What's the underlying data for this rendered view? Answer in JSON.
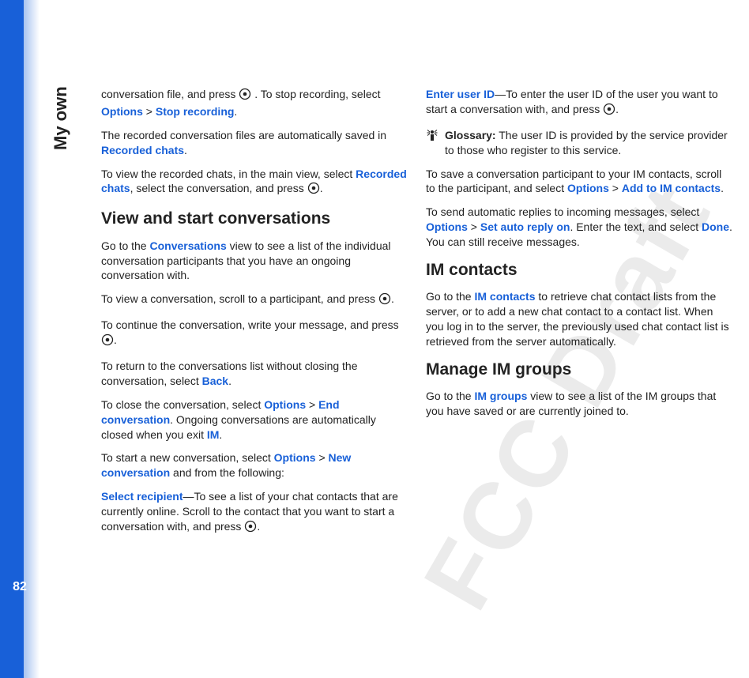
{
  "meta": {
    "side_title": "My own",
    "page_number": "82",
    "watermark": "FCC Draft"
  },
  "left": {
    "p1_a": "conversation file, and press ",
    "p1_b": ". To stop recording, select ",
    "p1_opt": "Options",
    "p1_gt": " > ",
    "p1_stop": "Stop recording",
    "p1_end": ".",
    "p2_a": "The recorded conversation files are automatically saved in ",
    "p2_rec": "Recorded chats",
    "p2_end": ".",
    "p3_a": "To view the recorded chats, in the main view, select ",
    "p3_rec": "Recorded chats",
    "p3_b": ", select the conversation, and press ",
    "p3_end": ".",
    "h_view": "View and start conversations",
    "p4_a": "Go to the ",
    "p4_conv": "Conversations",
    "p4_b": " view to see a list of the individual conversation participants that you have an ongoing conversation with.",
    "p5_a": "To view a conversation, scroll to a participant, and press ",
    "p5_end": ".",
    "p6_a": "To continue the conversation, write your message, and press ",
    "p6_end": ".",
    "p7_a": "To return to the conversations list without closing the conversation, select ",
    "p7_back": "Back",
    "p7_end": ".",
    "p8_a": "To close the conversation, select ",
    "p8_opt": "Options",
    "p8_gt": " > ",
    "p8_endconv": "End conversation",
    "p8_b": ". Ongoing conversations are automatically closed when you exit ",
    "p8_im": "IM",
    "p8_end": ".",
    "p9_a": "To start a new conversation, select ",
    "p9_opt": "Options",
    "p9_gt": " > ",
    "p9_new": "New conversation",
    "p9_b": " and from the following:"
  },
  "right": {
    "p1_sel": "Select recipient",
    "p1_a": "—To see a list of your chat contacts that are currently online. Scroll to the contact that you want to start a conversation with, and press ",
    "p1_end": ".",
    "p2_ent": "Enter user ID",
    "p2_a": "—To enter the user ID of the user you want to start a conversation with, and press ",
    "p2_end": ".",
    "gloss_lbl": "Glossary:",
    "gloss_txt": " The user ID is provided by the service provider to those who register to this service.",
    "p3_a": "To save a conversation participant to your IM contacts, scroll to the participant, and select ",
    "p3_opt": "Options",
    "p3_gt": " > ",
    "p3_add": "Add to IM contacts",
    "p3_end": ".",
    "p4_a": "To send automatic replies to incoming messages, select ",
    "p4_opt": "Options",
    "p4_gt": " > ",
    "p4_auto": "Set auto reply on",
    "p4_b": ". Enter the text, and select ",
    "p4_done": "Done",
    "p4_c": ". You can still receive messages.",
    "h_im": "IM contacts",
    "p5_a": "Go to the ",
    "p5_imc": "IM contacts",
    "p5_b": " to retrieve chat contact lists from the server, or to add a new chat contact to a contact list. When you log in to the server, the previously used chat contact list is retrieved from the server automatically.",
    "h_mg": "Manage IM groups",
    "p6_a": "Go to the ",
    "p6_img": "IM groups",
    "p6_b": " view to see a list of the IM groups that you have saved or are currently joined to."
  }
}
